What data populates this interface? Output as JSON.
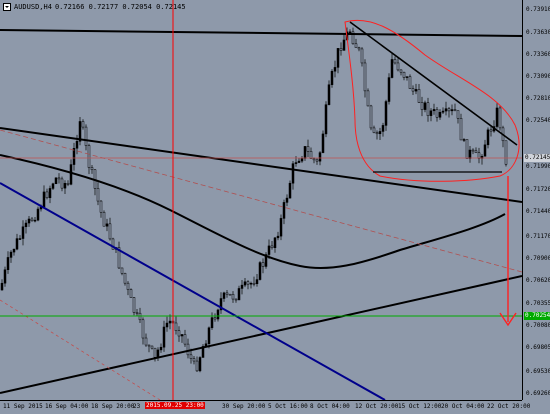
{
  "header": {
    "symbol": "AUDUSD,H4",
    "ohlc": "0.72166 0.72177 0.72054 0.72145"
  },
  "price_axis": {
    "labels": [
      "0.73910",
      "0.73630",
      "0.73360",
      "0.73090",
      "0.72810",
      "0.72540",
      "0.71990",
      "0.71720",
      "0.71440",
      "0.71170",
      "0.70900",
      "0.70620",
      "0.70355",
      "0.70080",
      "0.69805",
      "0.69530",
      "0.69260"
    ],
    "current_price": "0.72145",
    "hline_price": "0.70254"
  },
  "time_axis": {
    "labels": [
      "11 Sep 2015",
      "16 Sep 04:00",
      "18 Sep 20:00",
      "23",
      "30 Sep 20:00",
      "5 Oct 16:00",
      "8 Oct 04:00",
      "12 Oct 20:00",
      "15 Oct 12:00",
      "20 Oct 04:00",
      "22 Oct 20:00"
    ],
    "vline_label": "2015.09.25 23:00"
  },
  "colors": {
    "background": "#8e99aa",
    "bull_candle": "#000000",
    "bear_candle": "#000000",
    "current_price_badge": "#cfd3da",
    "horizontal_level": "#00aa00",
    "vertical_line": "#ff0000",
    "downtrend_line": "#00008b",
    "annotation": "#ff0000"
  }
}
